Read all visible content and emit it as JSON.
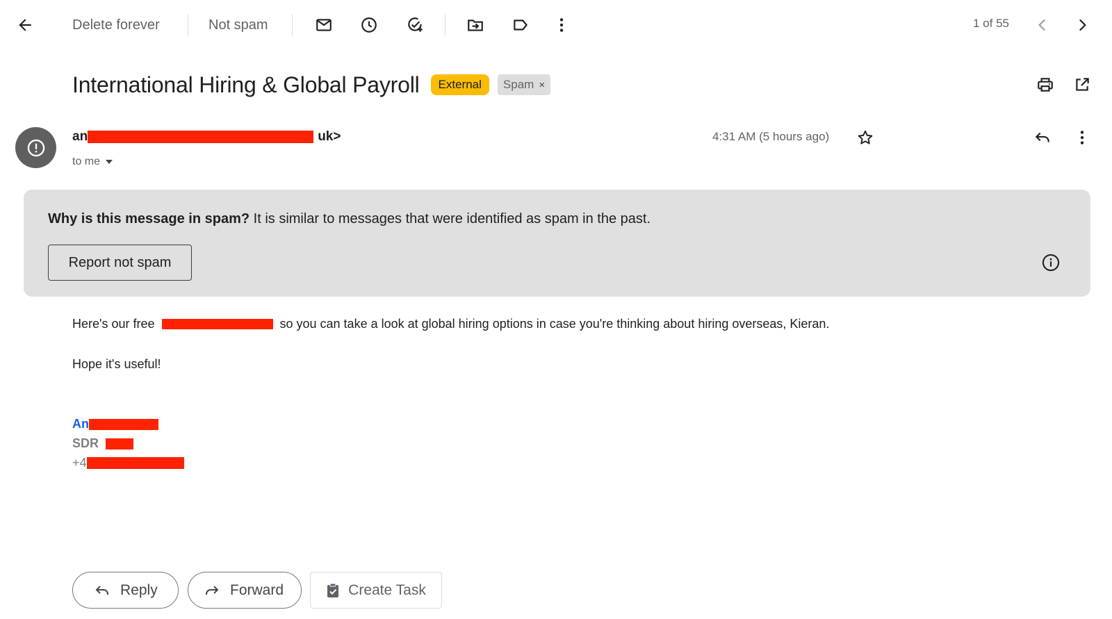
{
  "toolbar": {
    "back_icon": "arrow-left-icon",
    "delete_forever_label": "Delete forever",
    "not_spam_label": "Not spam",
    "icons": [
      "mail-icon",
      "snooze-clock-icon",
      "add-task-icon",
      "move-to-icon",
      "label-icon",
      "more-vert-icon"
    ],
    "pager": "1 of 55"
  },
  "subject": {
    "title": "International Hiring & Global Payroll",
    "external_chip": "External",
    "spam_chip": "Spam",
    "spam_chip_close": "×"
  },
  "message": {
    "sender_prefix": "an",
    "sender_suffix": "uk>",
    "to": "to me",
    "time": "4:31 AM (5 hours ago)"
  },
  "spam_notice": {
    "question": "Why is this message in spam?",
    "explanation": " It is similar to messages that were identified as spam in the past.",
    "report_button": "Report not spam"
  },
  "body": {
    "line1_prefix": "Here's our free",
    "line1_suffix": "so you can take a look at global hiring options in case you're thinking about hiring overseas, Kieran.",
    "line2": "Hope it's useful!"
  },
  "signature": {
    "name_prefix": "An",
    "title_prefix": "SDR",
    "phone_prefix": "+4"
  },
  "actions": {
    "reply": "Reply",
    "forward": "Forward",
    "create_task": "Create Task"
  },
  "colors": {
    "external_chip": "#fbbc04",
    "spam_notice_bg": "#e0e0e0",
    "redaction": "#ff2200",
    "signature_name": "#1a5fd8"
  }
}
